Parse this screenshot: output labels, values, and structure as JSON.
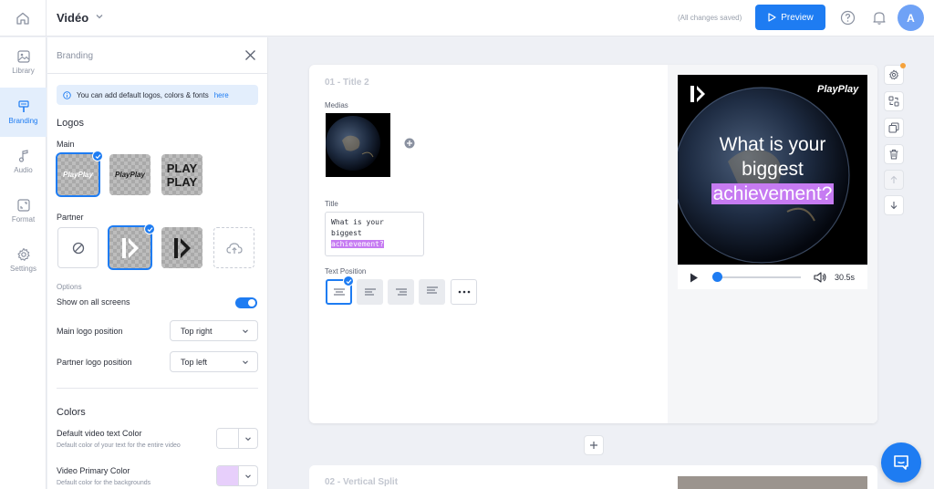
{
  "app": {
    "project_title": "Vidéo",
    "save_status": "(All changes saved)",
    "preview_label": "Preview",
    "avatar_initial": "A",
    "accent": "#1e7cf2"
  },
  "rail": {
    "items": [
      {
        "label": "Library",
        "icon": "library-icon"
      },
      {
        "label": "Branding",
        "icon": "branding-icon"
      },
      {
        "label": "Audio",
        "icon": "music-note-icon"
      },
      {
        "label": "Format",
        "icon": "format-icon"
      },
      {
        "label": "Settings",
        "icon": "gear-icon"
      }
    ],
    "active": "Branding"
  },
  "branding": {
    "title": "Branding",
    "info_text": "You can add default logos, colors & fonts",
    "info_link": "here",
    "logos_heading": "Logos",
    "main_label": "Main",
    "partner_label": "Partner",
    "main_logos": [
      {
        "text": "PlayPlay",
        "selected": true
      },
      {
        "text": "PlayPlay",
        "selected": false
      },
      {
        "text": "PLAY PLAY",
        "selected": false
      }
    ],
    "options_label": "Options",
    "show_all_screens_label": "Show on all screens",
    "show_all_screens_on": true,
    "main_logo_position_label": "Main logo position",
    "main_logo_position_value": "Top right",
    "partner_logo_position_label": "Partner logo position",
    "partner_logo_position_value": "Top left",
    "colors_heading": "Colors",
    "text_color_title": "Default video text Color",
    "text_color_sub": "Default color of your text for the entire video",
    "text_color_value": "#ffffff",
    "primary_color_title": "Video Primary Color",
    "primary_color_sub": "Default color for the backgrounds",
    "primary_color_value": "#e7cffb"
  },
  "scene1": {
    "title": "01 - Title 2",
    "medias_label": "Medias",
    "title_label": "Title",
    "title_text_plain": "What is your biggest",
    "title_text_highlight": "achievement?",
    "text_position_label": "Text Position",
    "preview_title_line1": "What is your",
    "preview_title_line2": "biggest",
    "preview_title_highlight": "achievement?",
    "brand_word": "PlayPlay",
    "duration": "30.5s",
    "progress": 0.02,
    "highlight_color": "#c67bf2"
  },
  "scene2": {
    "title": "02 - Vertical Split"
  }
}
